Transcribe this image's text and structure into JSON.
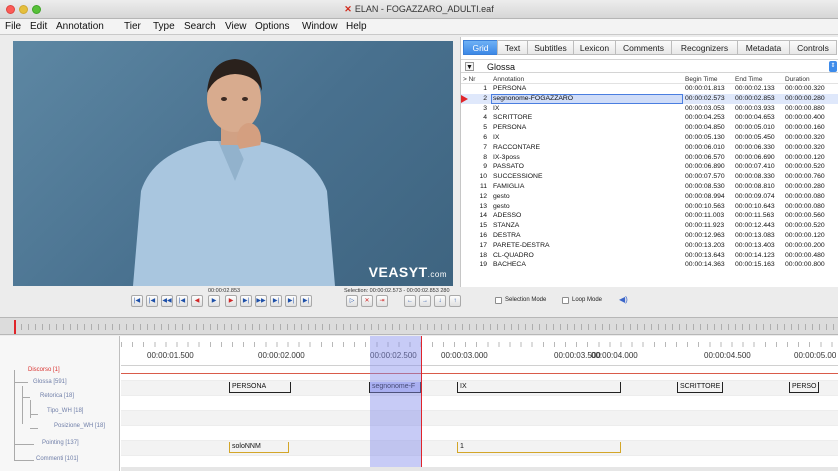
{
  "window": {
    "title": "ELAN - FOGAZZARO_ADULTI.eaf"
  },
  "menu": [
    "File",
    "Edit",
    "Annotation",
    "Tier",
    "Type",
    "Search",
    "View",
    "Options",
    "Window",
    "Help"
  ],
  "video": {
    "watermark": "VEASYT",
    "watermark_suffix": ".com"
  },
  "tabs": [
    "Grid",
    "Text",
    "Subtitles",
    "Lexicon",
    "Comments",
    "Recognizers",
    "Metadata",
    "Controls"
  ],
  "active_tab": "Grid",
  "tier_select": {
    "value": "Glossa"
  },
  "grid": {
    "headers": {
      "nr": "> Nr",
      "annotation": "Annotation",
      "begin": "Begin Time",
      "end": "End Time",
      "duration": "Duration"
    },
    "rows": [
      {
        "nr": "1",
        "annotation": "PERSONA",
        "begin": "00:00:01.813",
        "end": "00:00:02.133",
        "duration": "00:00:00.320"
      },
      {
        "nr": "2",
        "annotation": "segnonome-FOGAZZARO",
        "begin": "00:00:02.573",
        "end": "00:00:02.853",
        "duration": "00:00:00.280"
      },
      {
        "nr": "3",
        "annotation": "IX",
        "begin": "00:00:03.053",
        "end": "00:00:03.933",
        "duration": "00:00:00.880"
      },
      {
        "nr": "4",
        "annotation": "SCRITTORE",
        "begin": "00:00:04.253",
        "end": "00:00:04.653",
        "duration": "00:00:00.400"
      },
      {
        "nr": "5",
        "annotation": "PERSONA",
        "begin": "00:00:04.850",
        "end": "00:00:05.010",
        "duration": "00:00:00.160"
      },
      {
        "nr": "6",
        "annotation": "IX",
        "begin": "00:00:05.130",
        "end": "00:00:05.450",
        "duration": "00:00:00.320"
      },
      {
        "nr": "7",
        "annotation": "RACCONTARE",
        "begin": "00:00:06.010",
        "end": "00:00:06.330",
        "duration": "00:00:00.320"
      },
      {
        "nr": "8",
        "annotation": "IX-3poss",
        "begin": "00:00:06.570",
        "end": "00:00:06.690",
        "duration": "00:00:00.120"
      },
      {
        "nr": "9",
        "annotation": "PASSATO",
        "begin": "00:00:06.890",
        "end": "00:00:07.410",
        "duration": "00:00:00.520"
      },
      {
        "nr": "10",
        "annotation": "SUCCESSIONE",
        "begin": "00:00:07.570",
        "end": "00:00:08.330",
        "duration": "00:00:00.760"
      },
      {
        "nr": "11",
        "annotation": "FAMIGLIA",
        "begin": "00:00:08.530",
        "end": "00:00:08.810",
        "duration": "00:00:00.280"
      },
      {
        "nr": "12",
        "annotation": "gesto",
        "begin": "00:00:08.994",
        "end": "00:00:09.074",
        "duration": "00:00:00.080"
      },
      {
        "nr": "13",
        "annotation": "gesto",
        "begin": "00:00:10.563",
        "end": "00:00:10.643",
        "duration": "00:00:00.080"
      },
      {
        "nr": "14",
        "annotation": "ADESSO",
        "begin": "00:00:11.003",
        "end": "00:00:11.563",
        "duration": "00:00:00.560"
      },
      {
        "nr": "15",
        "annotation": "STANZA",
        "begin": "00:00:11.923",
        "end": "00:00:12.443",
        "duration": "00:00:00.520"
      },
      {
        "nr": "16",
        "annotation": "DESTRA",
        "begin": "00:00:12.963",
        "end": "00:00:13.083",
        "duration": "00:00:00.120"
      },
      {
        "nr": "17",
        "annotation": "PARETE-DESTRA",
        "begin": "00:00:13.203",
        "end": "00:00:13.403",
        "duration": "00:00:00.200"
      },
      {
        "nr": "18",
        "annotation": "CL-QUADRO",
        "begin": "00:00:13.643",
        "end": "00:00:14.123",
        "duration": "00:00:00.480"
      },
      {
        "nr": "19",
        "annotation": "BACHECA",
        "begin": "00:00:14.363",
        "end": "00:00:15.163",
        "duration": "00:00:00.800"
      }
    ],
    "selected_row": 1
  },
  "controls": {
    "current_time": "00:00:02.853",
    "selection": "Selection: 00:00:02.573 - 00:00:02.853  280",
    "selection_mode_label": "Selection Mode",
    "loop_mode_label": "Loop Mode"
  },
  "timeline": {
    "ticks": [
      "00:00:01.500",
      "00:00:02.000",
      "00:00:02.500",
      "00:00:03.000",
      "00:00:03.500",
      "00:00:04.000",
      "00:00:04.500",
      "00:00:05.00"
    ],
    "tiers": [
      {
        "name": "Discorso [1]",
        "active": true
      },
      {
        "name": "Glossa [591]",
        "active": false
      },
      {
        "name": "Retorica [18]",
        "active": false
      },
      {
        "name": "Tipo_WH [18]",
        "active": false
      },
      {
        "name": "Posizione_WH [18]",
        "active": false
      },
      {
        "name": "Pointing [137]",
        "active": false
      },
      {
        "name": "Commenti [101]",
        "active": false
      }
    ],
    "glossa_annotations": [
      "PERSONA",
      "segnonome-F",
      "IX",
      "SCRITTORE",
      "PERSO"
    ],
    "pointing_annotations": [
      "soloNNM",
      "1"
    ]
  },
  "colors": {
    "accent": "#3c88e6",
    "cursor": "#e0252a",
    "selection": "#8c96eb"
  }
}
